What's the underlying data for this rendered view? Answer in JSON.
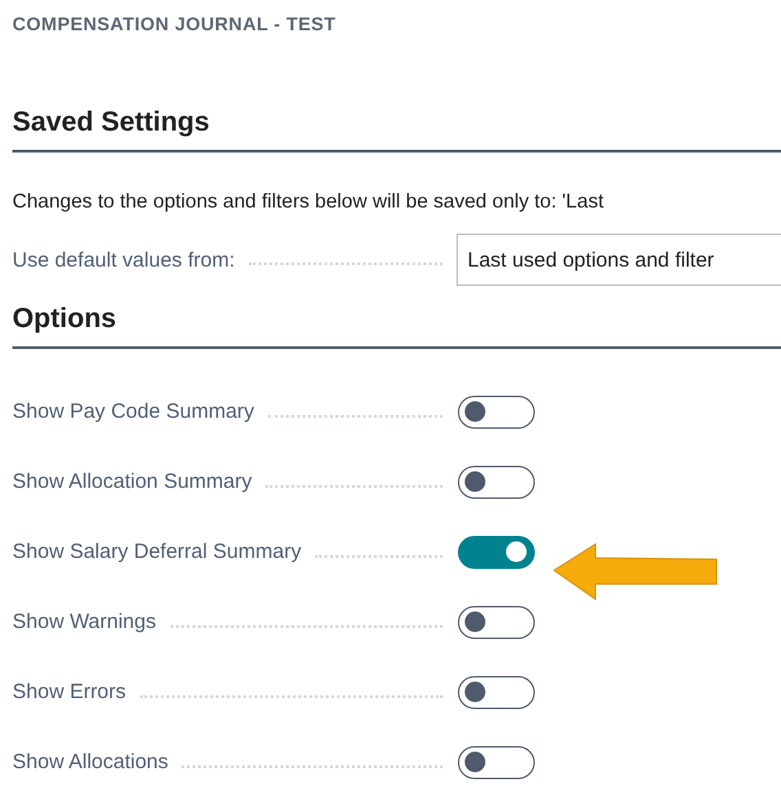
{
  "page_title": "COMPENSATION JOURNAL - TEST",
  "sections": [
    {
      "heading": "Saved Settings",
      "note": "Changes to the options and filters below will be saved only to: 'Last",
      "fields": [
        {
          "label": "Use default values from:",
          "value": "Last used options and filter"
        }
      ]
    },
    {
      "heading": "Options",
      "options": [
        {
          "label": "Show Pay Code Summary",
          "on": false
        },
        {
          "label": "Show Allocation Summary",
          "on": false
        },
        {
          "label": "Show Salary Deferral Summary",
          "on": true
        },
        {
          "label": "Show Warnings",
          "on": false
        },
        {
          "label": "Show Errors",
          "on": false
        },
        {
          "label": "Show Allocations",
          "on": false
        }
      ]
    }
  ]
}
